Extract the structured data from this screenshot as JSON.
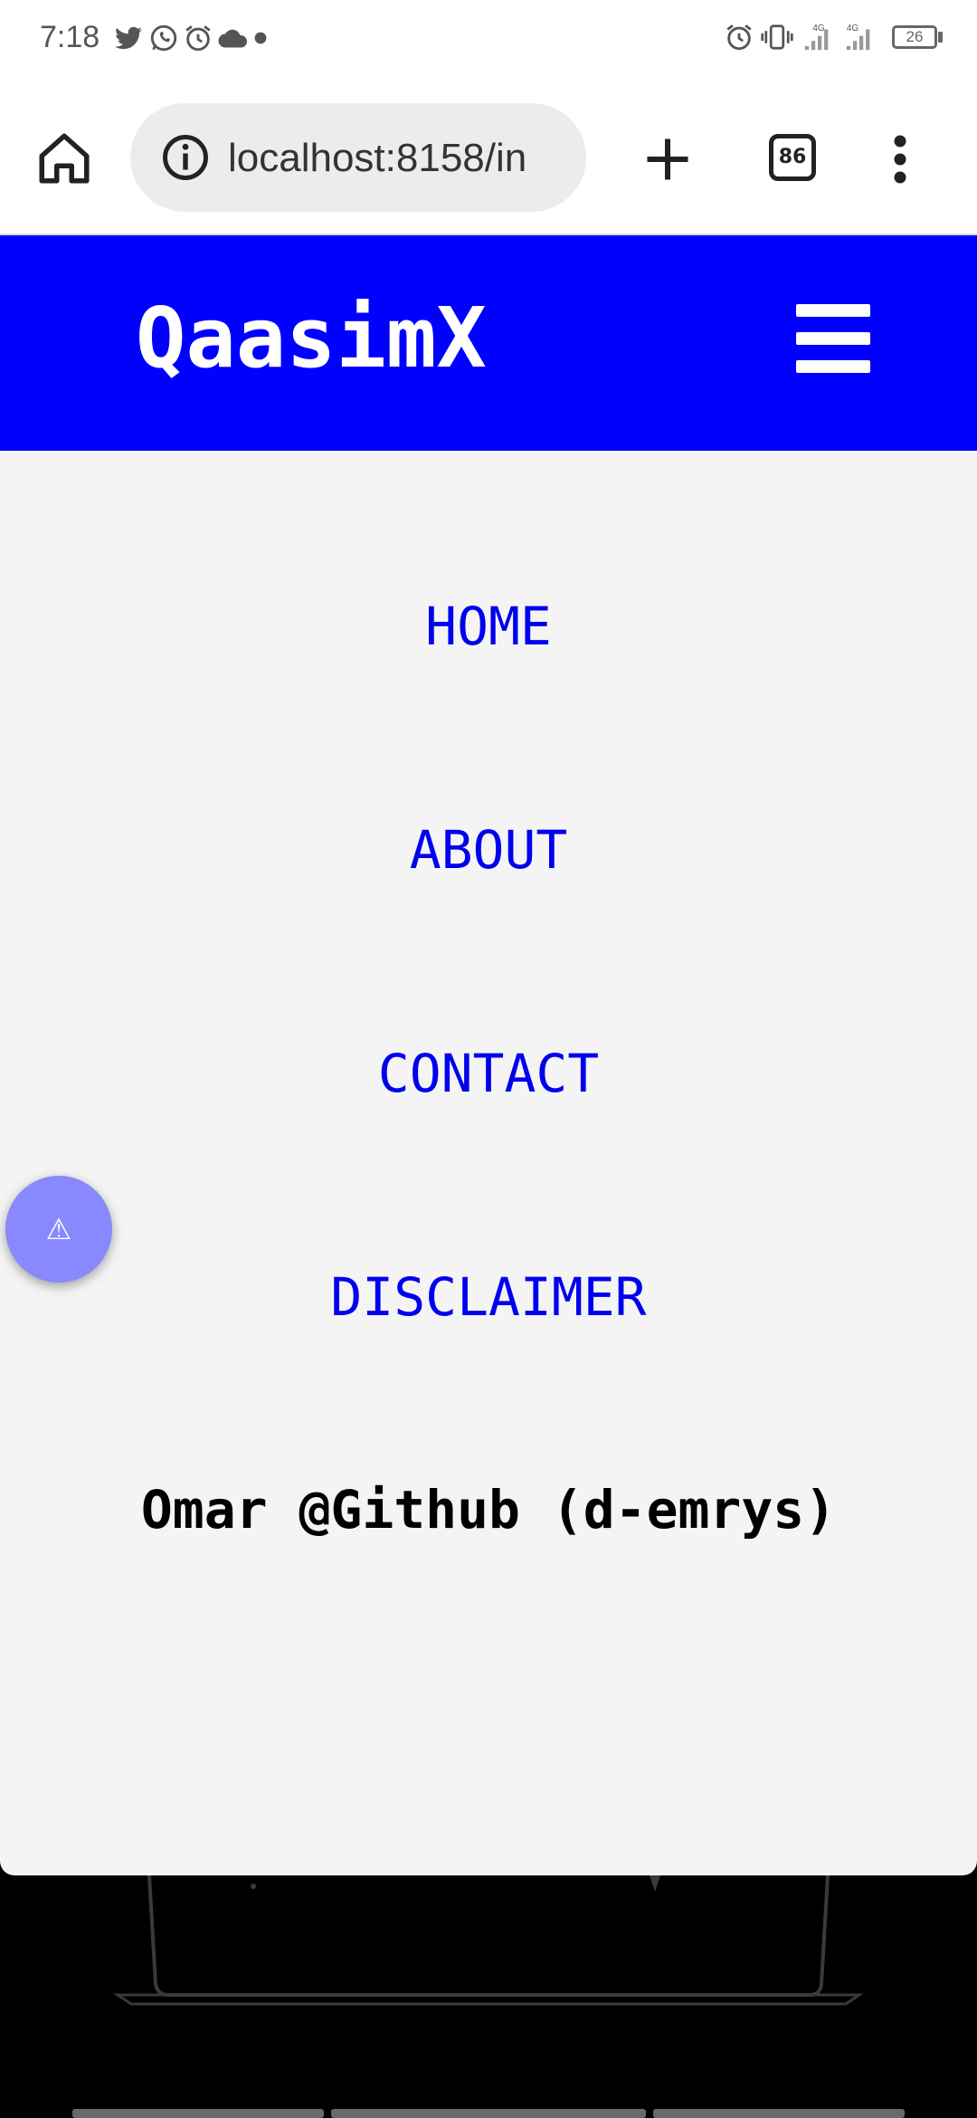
{
  "status_bar": {
    "time": "7:18",
    "left_icons": [
      "twitter-icon",
      "whatsapp-icon",
      "alarm-icon",
      "cloud-icon",
      "dot-icon"
    ],
    "right_icons": [
      "alarm-icon",
      "vibrate-icon",
      "signal-4g-icon",
      "signal-4g-icon"
    ],
    "network_1": "4G",
    "network_2": "4G",
    "battery": "26"
  },
  "browser": {
    "url": "localhost:8158/in",
    "tab_count": "86",
    "icons": {
      "home": "home-icon",
      "info": "info-icon",
      "new_tab": "plus-icon",
      "menu": "more-vert-icon"
    }
  },
  "site": {
    "logo": "QaasimX",
    "menu_icon": "hamburger-icon",
    "header_color": "#0000ff"
  },
  "nav": {
    "items": [
      {
        "label": "HOME"
      },
      {
        "label": "ABOUT"
      },
      {
        "label": "CONTACT"
      },
      {
        "label": "DISCLAIMER"
      }
    ],
    "credit": "Omar @Github (d-emrys)",
    "link_color": "#0000ee"
  },
  "fab": {
    "icon": "⚠",
    "icon_name": "warning-icon",
    "color": "#8888ff"
  }
}
